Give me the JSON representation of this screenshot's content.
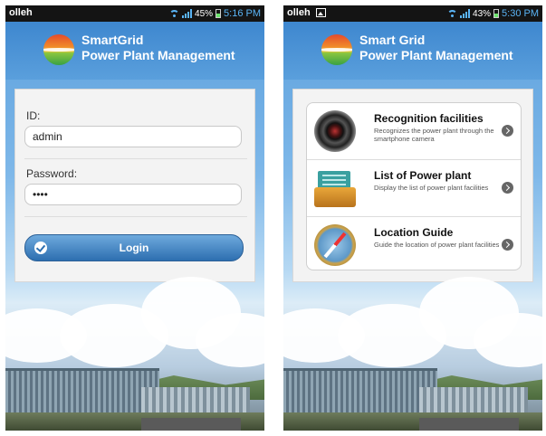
{
  "left": {
    "status": {
      "carrier": "olleh",
      "battery": "45%",
      "time": "5:16 PM"
    },
    "header": {
      "title_line1": "SmartGrid",
      "title_line2": "Power Plant Management"
    },
    "login": {
      "id_label": "ID:",
      "id_value": "admin",
      "password_label": "Password:",
      "password_value": "••••",
      "login_label": "Login"
    }
  },
  "right": {
    "status": {
      "carrier": "olleh",
      "battery": "43%",
      "time": "5:30 PM"
    },
    "header": {
      "title_line1": "Smart Grid",
      "title_line2": "Power Plant Management"
    },
    "menu": [
      {
        "title": "Recognition facilities",
        "desc": "Recognizes the power plant through the smartphone camera",
        "icon": "camera-icon"
      },
      {
        "title": "List of Power plant",
        "desc": "Display the list of power plant facilities",
        "icon": "folder-icon"
      },
      {
        "title": "Location Guide",
        "desc": "Guide the location of power plant facilities",
        "icon": "compass-icon"
      }
    ]
  },
  "colors": {
    "header": "#4a93d6",
    "status_bar": "#141414",
    "accent": "#2d6fb0",
    "status_text": "#5ab4f5"
  }
}
